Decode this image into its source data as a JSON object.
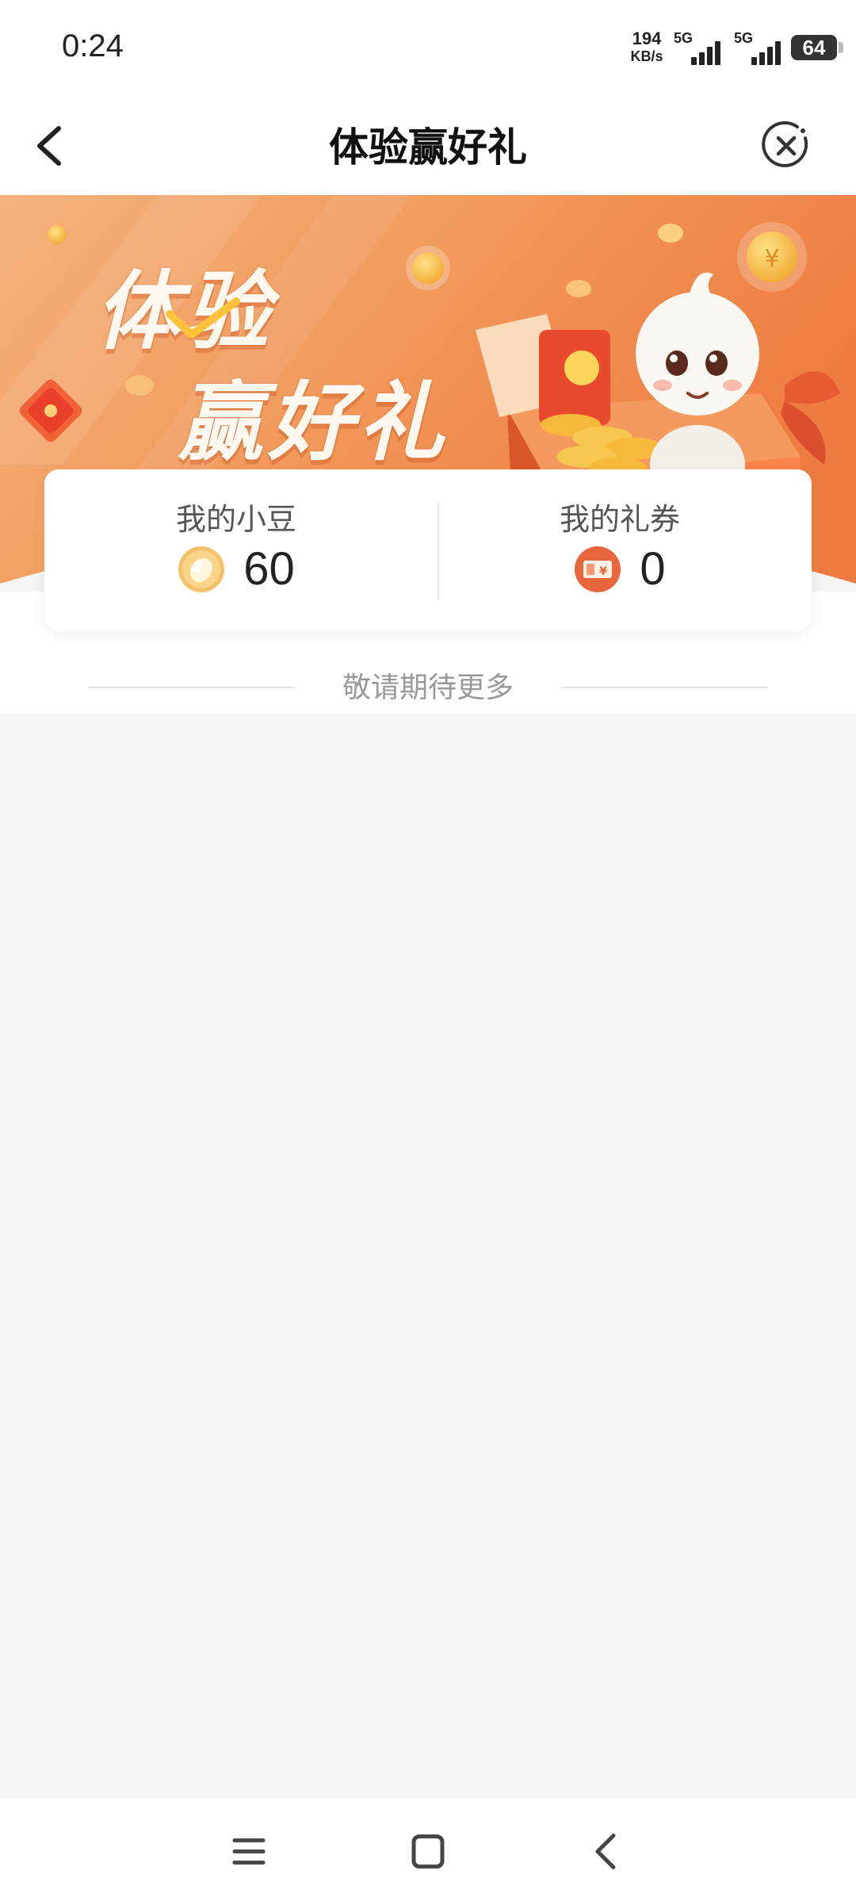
{
  "status_bar": {
    "time": "0:24",
    "net_speed_value": "194",
    "net_speed_unit": "KB/s",
    "signal1_label": "5G",
    "signal2_label": "5G",
    "battery": "64"
  },
  "nav": {
    "title": "体验赢好礼",
    "back_icon": "chevron-left-icon",
    "close_icon": "close-circle-icon"
  },
  "banner": {
    "line1": "体验",
    "line2": "赢好礼"
  },
  "stats": {
    "beans_label": "我的小豆",
    "beans_value": "60",
    "coupons_label": "我的礼券",
    "coupons_value": "0"
  },
  "hint": {
    "text": "敬请期待更多"
  },
  "system_nav": {
    "menu_icon": "menu-icon",
    "home_icon": "home-square-icon",
    "back_icon": "back-chevron-icon"
  },
  "colors": {
    "banner_orange": "#F08A4B",
    "banner_light": "#F7B07A",
    "bean_gold": "#F2B84B",
    "coupon_red": "#E8663C"
  }
}
